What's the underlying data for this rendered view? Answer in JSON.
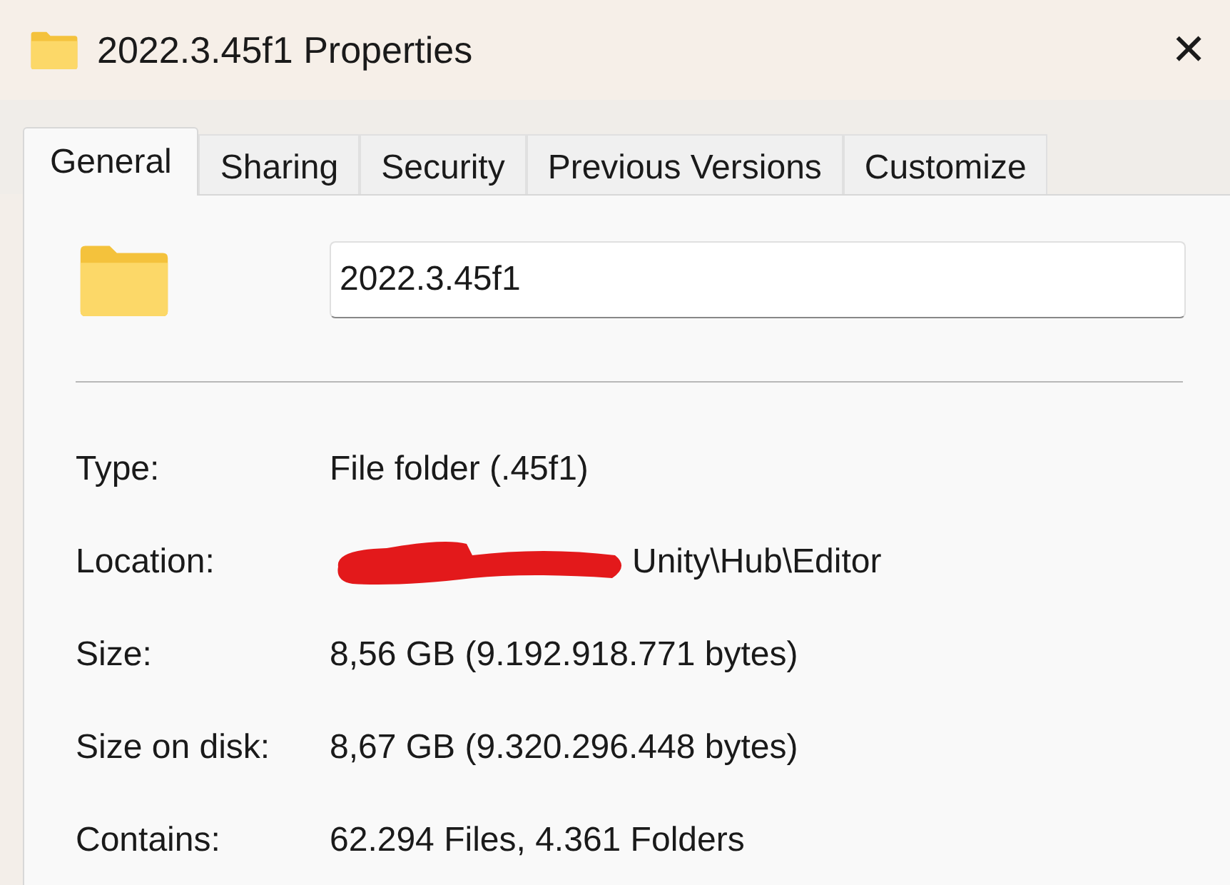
{
  "window": {
    "title": "2022.3.45f1 Properties",
    "close": "✕"
  },
  "tabs": [
    {
      "label": "General",
      "selected": true
    },
    {
      "label": "Sharing",
      "selected": false
    },
    {
      "label": "Security",
      "selected": false
    },
    {
      "label": "Previous Versions",
      "selected": false
    },
    {
      "label": "Customize",
      "selected": false
    }
  ],
  "name_field": {
    "value": "2022.3.45f1"
  },
  "properties": [
    {
      "label": "Type:",
      "value": "File folder (.45f1)",
      "redacted": false
    },
    {
      "label": "Location:",
      "value": "Unity\\Hub\\Editor",
      "redacted": true
    },
    {
      "label": "Size:",
      "value": "8,56 GB (9.192.918.771 bytes)",
      "redacted": false
    },
    {
      "label": "Size on disk:",
      "value": "8,67 GB (9.320.296.448 bytes)",
      "redacted": false
    },
    {
      "label": "Contains:",
      "value": "62.294 Files, 4.361 Folders",
      "redacted": false
    }
  ]
}
